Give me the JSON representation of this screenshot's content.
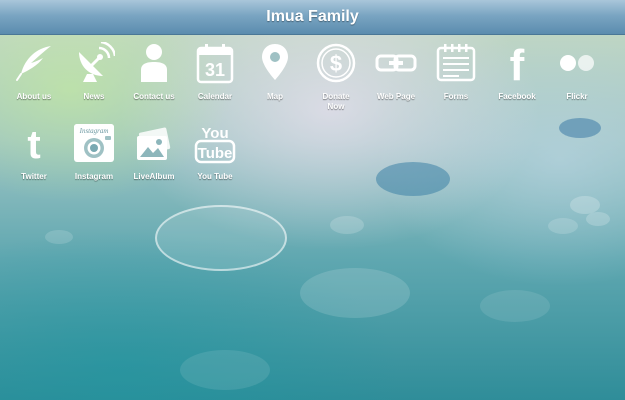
{
  "header": {
    "title": "Imua Family"
  },
  "icons": [
    {
      "id": "about",
      "label": "About us",
      "icon": "feather-icon"
    },
    {
      "id": "news",
      "label": "News",
      "icon": "satellite-dish-icon"
    },
    {
      "id": "contact",
      "label": "Contact us",
      "icon": "person-icon"
    },
    {
      "id": "calendar",
      "label": "Calendar",
      "icon": "calendar-icon",
      "day": "31"
    },
    {
      "id": "map",
      "label": "Map",
      "icon": "map-pin-icon"
    },
    {
      "id": "donate",
      "label": "Donate Now",
      "icon": "dollar-coin-icon",
      "symbol": "$"
    },
    {
      "id": "webpage",
      "label": "Web Page",
      "icon": "chain-link-icon"
    },
    {
      "id": "forms",
      "label": "Forms",
      "icon": "form-notebook-icon"
    },
    {
      "id": "facebook",
      "label": "Facebook",
      "icon": "facebook-icon",
      "glyph": "f"
    },
    {
      "id": "flickr",
      "label": "Flickr",
      "icon": "flickr-icon"
    },
    {
      "id": "twitter",
      "label": "Twitter",
      "icon": "twitter-icon",
      "glyph": "t"
    },
    {
      "id": "instagram",
      "label": "Instagram",
      "icon": "instagram-icon",
      "wordmark": "Instagram"
    },
    {
      "id": "livealbum",
      "label": "LiveAlbum",
      "icon": "photo-album-icon"
    },
    {
      "id": "youtube",
      "label": "You Tube",
      "icon": "youtube-icon",
      "top": "You",
      "bottom": "Tube"
    }
  ],
  "colors": {
    "header": "#6d9abb",
    "icon": "#ffffff"
  }
}
